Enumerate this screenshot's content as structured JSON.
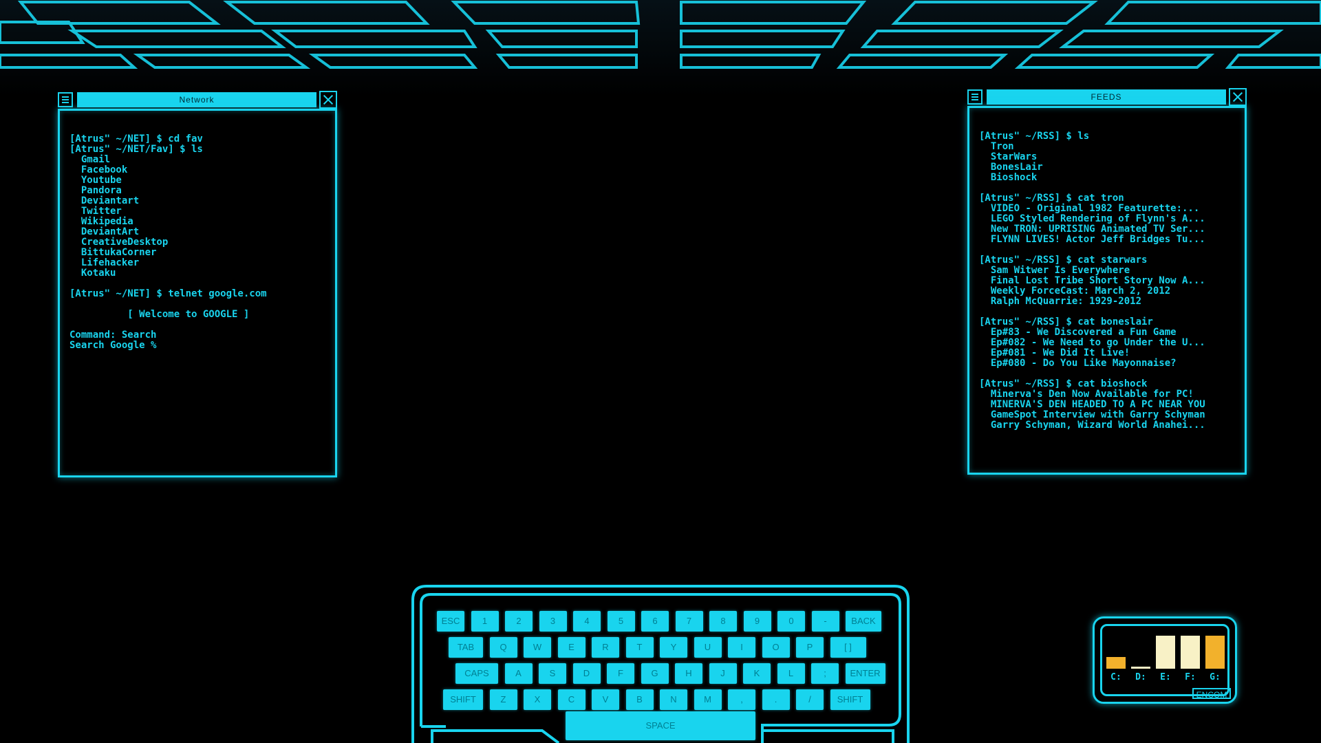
{
  "colors": {
    "accent": "#19d4ee",
    "drive_orange": "#f2b12c",
    "drive_pale": "#f8f1c6"
  },
  "network": {
    "title": "Network",
    "lines": [
      "[Atrus\" ~/NET] $ cd fav",
      "[Atrus\" ~/NET/Fav] $ ls",
      "  Gmail",
      "  Facebook",
      "  Youtube",
      "  Pandora",
      "  Deviantart",
      "  Twitter",
      "  Wikipedia",
      "  DeviantArt",
      "  CreativeDesktop",
      "  BittukaCorner",
      "  Lifehacker",
      "  Kotaku",
      "",
      "[Atrus\" ~/NET] $ telnet google.com",
      "",
      "          [ Welcome to GOOGLE ]",
      "",
      "Command: Search",
      "Search Google %"
    ]
  },
  "feeds": {
    "title": "FEEDS",
    "lines": [
      "[Atrus\" ~/RSS] $ ls",
      "  Tron",
      "  StarWars",
      "  BonesLair",
      "  Bioshock",
      "",
      "[Atrus\" ~/RSS] $ cat tron",
      "  VIDEO - Original 1982 Featurette:...",
      "  LEGO Styled Rendering of Flynn's A...",
      "  New TRON: UPRISING Animated TV Ser...",
      "  FLYNN LIVES! Actor Jeff Bridges Tu...",
      "",
      "[Atrus\" ~/RSS] $ cat starwars",
      "  Sam Witwer Is Everywhere",
      "  Final Lost Tribe Short Story Now A...",
      "  Weekly ForceCast: March 2, 2012",
      "  Ralph McQuarrie: 1929-2012",
      "",
      "[Atrus\" ~/RSS] $ cat boneslair",
      "  Ep#83 - We Discovered a Fun Game",
      "  Ep#082 - We Need to go Under the U...",
      "  Ep#081 - We Did It Live!",
      "  Ep#080 - Do You Like Mayonnaise?",
      "",
      "[Atrus\" ~/RSS] $ cat bioshock",
      "  Minerva's Den Now Available for PC!",
      "  MINERVA'S DEN HEADED TO A PC NEAR YOU",
      "  GameSpot Interview with Garry Schyman",
      "  Garry Schyman, Wizard World Anahei..."
    ]
  },
  "keyboard": {
    "rows": [
      [
        "ESC",
        "1",
        "2",
        "3",
        "4",
        "5",
        "6",
        "7",
        "8",
        "9",
        "0",
        "-",
        "BACK"
      ],
      [
        "TAB",
        "Q",
        "W",
        "E",
        "R",
        "T",
        "Y",
        "U",
        "I",
        "O",
        "P",
        "[ ]"
      ],
      [
        "CAPS",
        "A",
        "S",
        "D",
        "F",
        "G",
        "H",
        "J",
        "K",
        "L",
        ";",
        "ENTER"
      ],
      [
        "SHIFT",
        "Z",
        "X",
        "C",
        "V",
        "B",
        "N",
        "M",
        ",",
        ".",
        "/",
        "SHIFT"
      ]
    ],
    "space": "SPACE"
  },
  "drives": {
    "items": [
      {
        "label": "C:",
        "fill": 0.3,
        "color": "orange"
      },
      {
        "label": "D:",
        "fill": 0.06,
        "color": "pale"
      },
      {
        "label": "E:",
        "fill": 0.85,
        "color": "pale"
      },
      {
        "label": "F:",
        "fill": 0.85,
        "color": "pale"
      },
      {
        "label": "G:",
        "fill": 0.85,
        "color": "orange"
      }
    ],
    "brand": "ENCOM"
  }
}
